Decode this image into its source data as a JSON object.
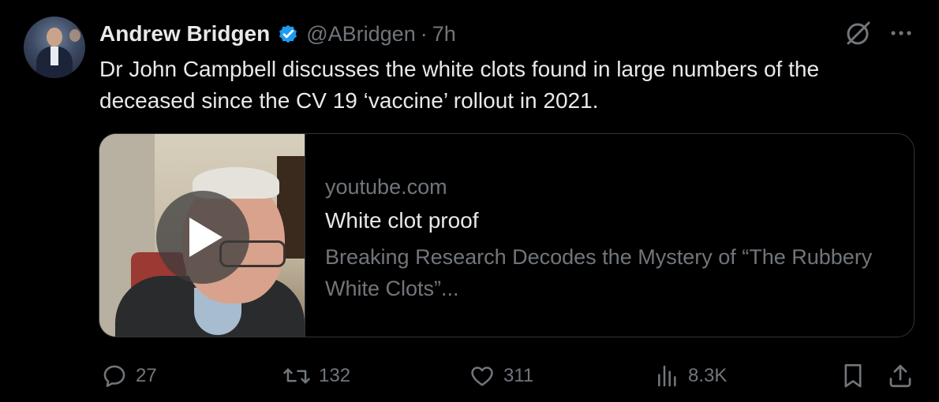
{
  "author": {
    "display_name": "Andrew Bridgen",
    "handle": "@ABridgen",
    "separator": "·",
    "time": "7h",
    "verified_icon": "verified-badge-icon"
  },
  "tweet": {
    "text": "Dr John Campbell discusses the white clots found in large numbers of the deceased since the CV 19 ‘vaccine’ rollout in 2021."
  },
  "card": {
    "domain": "youtube.com",
    "title": "White clot proof",
    "description": "Breaking Research Decodes the Mystery of “The Rubbery White Clots”..."
  },
  "actions": {
    "replies": "27",
    "retweets": "132",
    "likes": "311",
    "views": "8.3K"
  },
  "colors": {
    "background": "#000000",
    "primary_text": "#e7e9ea",
    "secondary_text": "#71767b",
    "border": "#2f3336",
    "verified": "#1d9bf0"
  }
}
